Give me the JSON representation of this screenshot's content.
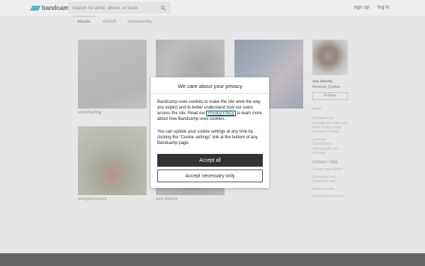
{
  "header": {
    "logo_text": "bandcamp",
    "search_placeholder": "Search for artist, album, or track",
    "signup_label": "sign up",
    "login_label": "log in"
  },
  "tabs": [
    "music",
    "merch",
    "community"
  ],
  "albums": [
    {
      "title": "untethering"
    },
    {
      "title": ""
    },
    {
      "title": ""
    },
    {
      "title": "sleeplessness"
    },
    {
      "title": "sea eleena"
    }
  ],
  "artist": {
    "name": "sea eleena",
    "location": "Montreal, Quebec",
    "follow_label": "Follow",
    "links": [
      "-",
      "twitter",
      "-",
      "Management: ruich@union-saint.org",
      "Artist image credit: Lawrence Ferlatt",
      "",
      "youtu.be",
      "SoundCloud",
      "sites.google.com",
      "linty.app"
    ],
    "contact_heading": "contact / help",
    "help_links": [
      "Contact sea eleena",
      "Streaming and Download help",
      "Redeem code",
      "Report this account"
    ]
  },
  "consent": {
    "title": "We care about your privacy",
    "para1_before": "Bandcamp uses cookies to make the site work the way you expect and to better understand how our users access the site. Read our ",
    "privacy_link": "Privacy Policy",
    "para1_after": " to learn more about how Bandcamp uses cookies.",
    "para2": "You can update your cookie settings at any time by clicking the “Cookie settings” link at the bottom of any Bandcamp page.",
    "accept_all_label": "Accept all",
    "accept_necessary_label": "Accept necessary only"
  },
  "colors": {
    "accent_green": "#7c9c7c",
    "brand_blue": "#1da0c3",
    "footer": "#262626"
  }
}
